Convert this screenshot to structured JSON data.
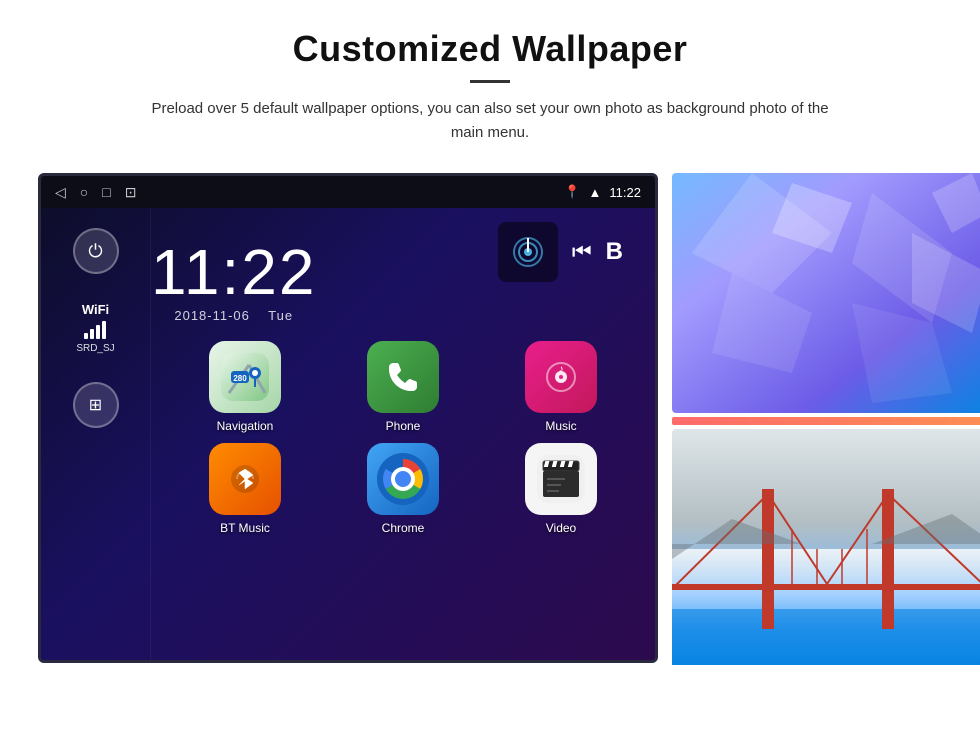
{
  "header": {
    "title": "Customized Wallpaper",
    "subtitle": "Preload over 5 default wallpaper options, you can also set your own photo as background photo of the main menu."
  },
  "device": {
    "status_bar": {
      "time": "11:22",
      "nav_icons": [
        "◁",
        "○",
        "□",
        "⊡"
      ]
    },
    "clock": {
      "time": "11:22",
      "date": "2018-11-06",
      "day": "Tue"
    },
    "sidebar": {
      "power_icon": "⏻",
      "wifi_label": "WiFi",
      "wifi_ssid": "SRD_SJ",
      "apps_icon": "⊞"
    },
    "apps": [
      {
        "id": "navigation",
        "label": "Navigation",
        "color_class": "app-navigation"
      },
      {
        "id": "phone",
        "label": "Phone",
        "color_class": "app-phone"
      },
      {
        "id": "music",
        "label": "Music",
        "color_class": "app-music"
      },
      {
        "id": "btmusic",
        "label": "BT Music",
        "color_class": "app-btmusic"
      },
      {
        "id": "chrome",
        "label": "Chrome",
        "color_class": "app-chrome"
      },
      {
        "id": "video",
        "label": "Video",
        "color_class": "app-video"
      }
    ]
  }
}
